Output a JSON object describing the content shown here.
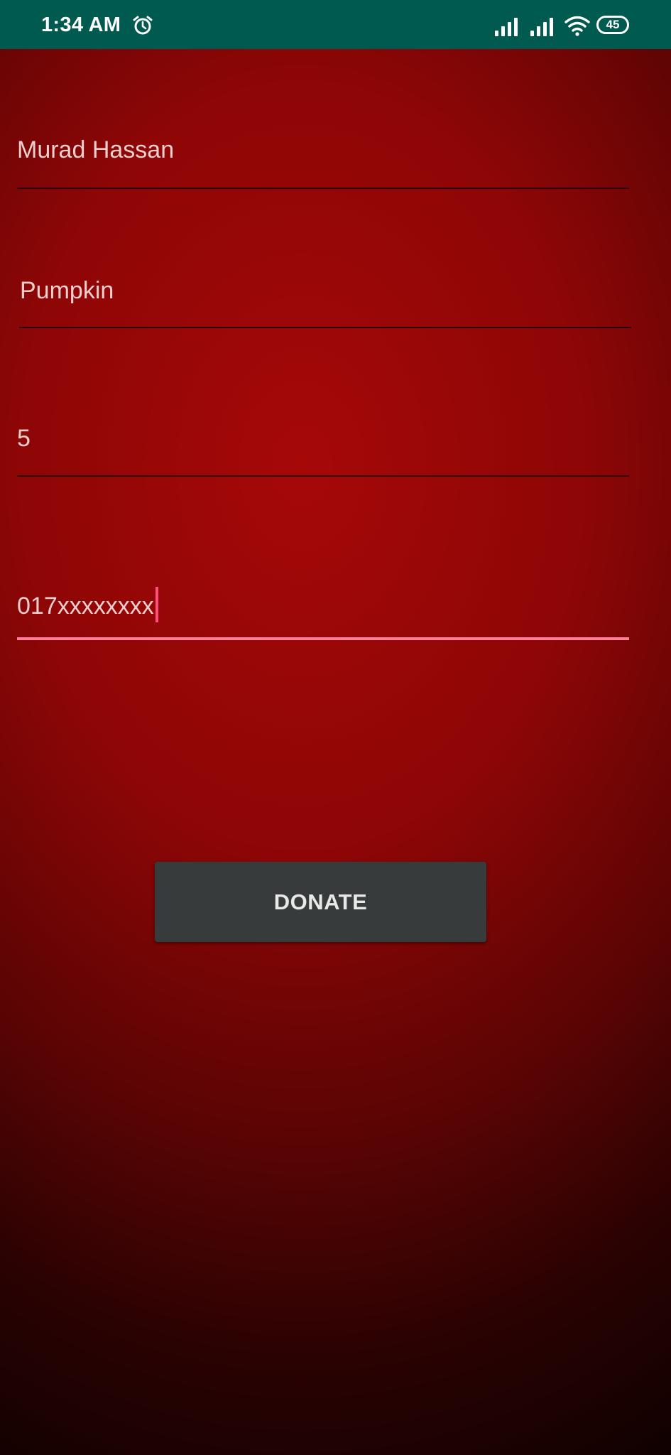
{
  "status_bar": {
    "time": "1:34 AM",
    "battery_level": "45",
    "icons": [
      "alarm-icon",
      "signal-icon",
      "signal-icon",
      "wifi-icon",
      "battery-icon"
    ],
    "background_color": "#005a4f"
  },
  "form": {
    "name_value": "Murad Hassan",
    "item_value": "Pumpkin",
    "quantity_value": "5",
    "phone_value": "017xxxxxxxx"
  },
  "donate_button": {
    "label": "DONATE"
  },
  "colors": {
    "background": "#8e0606",
    "active_underline": "#ff7f9c",
    "button": "#383b3b"
  }
}
